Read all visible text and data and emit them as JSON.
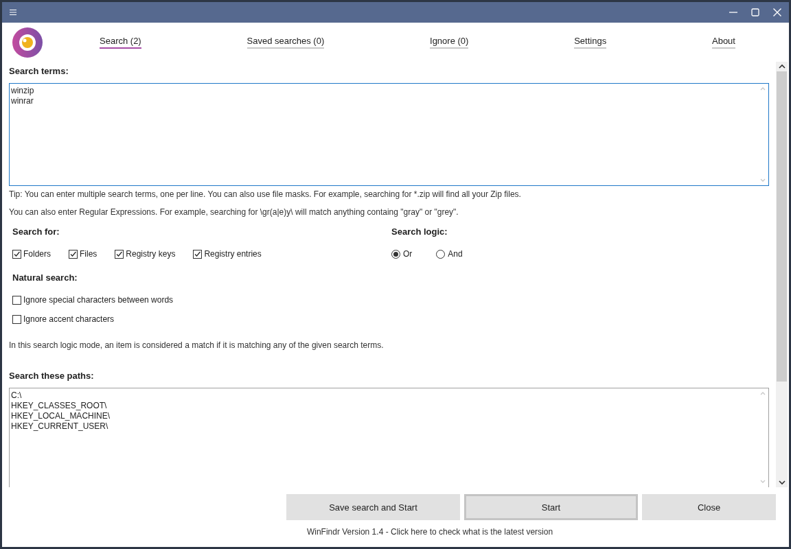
{
  "tabs": [
    {
      "label": "Search (2)",
      "selected": true
    },
    {
      "label": "Saved searches (0)",
      "selected": false
    },
    {
      "label": "Ignore (0)",
      "selected": false
    },
    {
      "label": "Settings",
      "selected": false
    },
    {
      "label": "About",
      "selected": false
    }
  ],
  "search_terms": {
    "label": "Search terms:",
    "value": "winzip\nwinrar"
  },
  "tips": [
    "Tip: You can enter multiple search terms, one per line. You can also use file masks. For example, searching for *.zip will find all your Zip files.",
    "You can also enter Regular Expressions. For example, searching for \\gr(a|e)y\\ will match anything containg \"gray\" or \"grey\"."
  ],
  "search_for": {
    "label": "Search for:",
    "options": [
      {
        "label": "Folders",
        "checked": true
      },
      {
        "label": "Files",
        "checked": true
      },
      {
        "label": "Registry keys",
        "checked": true
      },
      {
        "label": "Registry entries",
        "checked": true
      }
    ]
  },
  "search_logic": {
    "label": "Search logic:",
    "options": [
      {
        "label": "Or",
        "selected": true
      },
      {
        "label": "And",
        "selected": false
      }
    ]
  },
  "natural_search": {
    "label": "Natural search:",
    "options": [
      {
        "label": "Ignore special characters between words",
        "checked": false
      },
      {
        "label": "Ignore accent characters",
        "checked": false
      }
    ]
  },
  "logic_description": "In this search logic mode, an item is considered a match if it is matching any of the given search terms.",
  "search_paths": {
    "label": "Search these paths:",
    "value": "C:\\\nHKEY_CLASSES_ROOT\\\nHKEY_LOCAL_MACHINE\\\nHKEY_CURRENT_USER\\"
  },
  "buttons": [
    {
      "label": "Save search and Start",
      "kind": "normal"
    },
    {
      "label": "Start",
      "kind": "default"
    },
    {
      "label": "Close",
      "kind": "normal"
    }
  ],
  "footer_link": "WinFindr Version 1.4 - Click here to check what is the latest version"
}
